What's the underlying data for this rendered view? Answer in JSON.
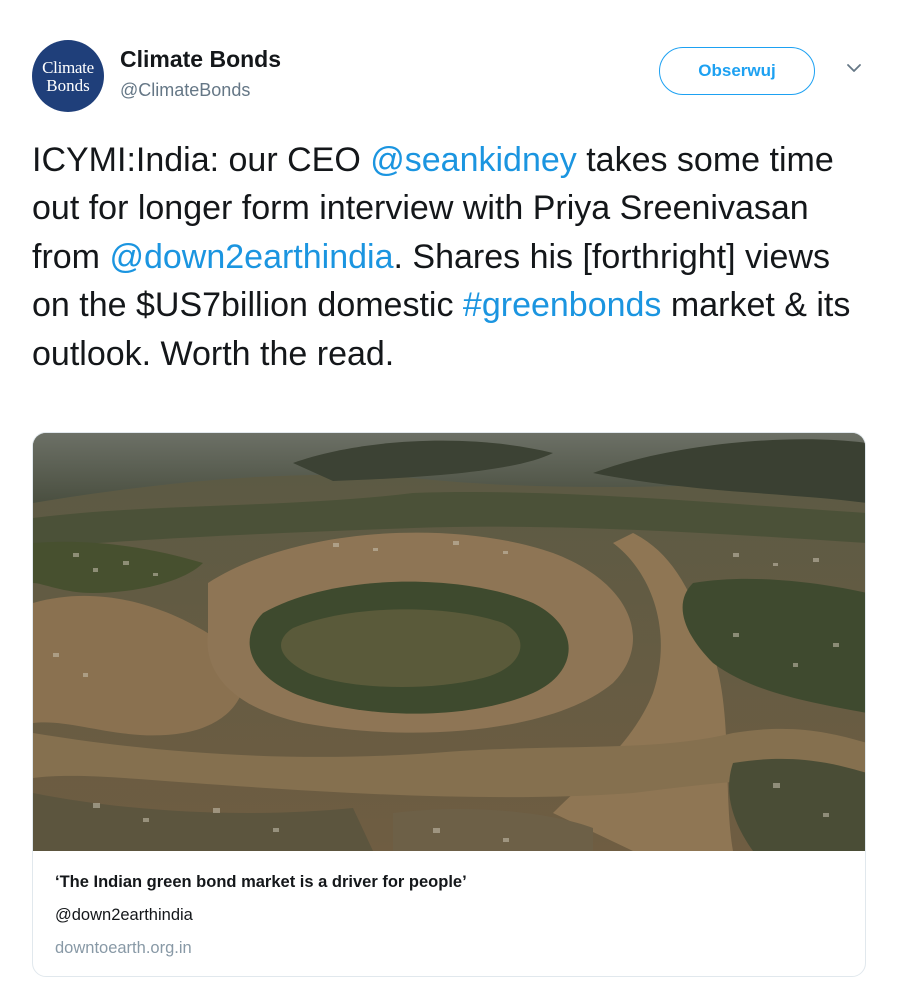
{
  "account": {
    "avatar_line1": "Climate",
    "avatar_line2": "Bonds",
    "name": "Climate Bonds",
    "handle": "@ClimateBonds"
  },
  "follow_label": "Obserwuj",
  "tweet": {
    "t1": "ICYMI:India: our CEO ",
    "mention1": "@seankidney",
    "t2": " takes some time out for longer form interview with Priya Sreenivasan from ",
    "mention2": "@down2earthindia",
    "t3": ". Shares his [forthright] views on the $US7billion domestic ",
    "hashtag": "#greenbonds",
    "t4": " market & its outlook. Worth the read."
  },
  "card": {
    "title": "‘The Indian green bond market is a driver for people’",
    "handle": "@down2earthindia",
    "domain": "downtoearth.org.in"
  },
  "colors": {
    "link": "#1b95e0",
    "follow_border": "#1da1f2",
    "avatar_bg": "#1f3f7a",
    "muted": "#657786"
  }
}
